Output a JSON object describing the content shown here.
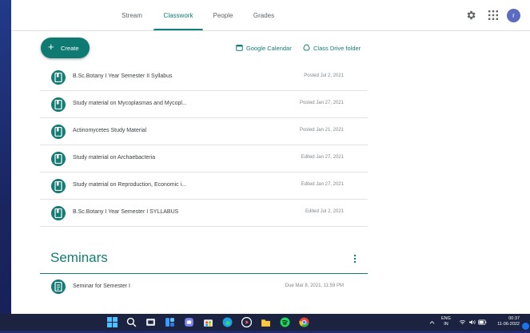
{
  "nav": {
    "tabs": [
      {
        "label": "Stream",
        "active": false
      },
      {
        "label": "Classwork",
        "active": true
      },
      {
        "label": "People",
        "active": false
      },
      {
        "label": "Grades",
        "active": false
      }
    ],
    "avatar_letter": "r",
    "icons": {
      "settings": "gear-icon",
      "apps": "apps-grid-icon"
    }
  },
  "toolbar": {
    "create_label": "Create",
    "calendar_label": "Google Calendar",
    "drive_label": "Class Drive folder"
  },
  "materials": [
    {
      "title": "B.Sc.Botany I Year Semester II Syllabus",
      "meta": "Posted Jul 2, 2021"
    },
    {
      "title": "Study material on Mycoplasmas and Mycopl...",
      "meta": "Posted Jan 27, 2021"
    },
    {
      "title": "Actinomycetes Study Material",
      "meta": "Posted Jan 21, 2021"
    },
    {
      "title": "Study material on Archaebacteria",
      "meta": "Edited Jan 27, 2021"
    },
    {
      "title": "Study material on Reproduction, Economic i...",
      "meta": "Edited Jan 27, 2021"
    },
    {
      "title": "B.Sc.Botany I Year Semester I SYLLABUS",
      "meta": "Edited Jul 2, 2021"
    }
  ],
  "seminars": {
    "title": "Seminars",
    "items": [
      {
        "title": "Seminar for Semester I",
        "meta": "Due Mar 8, 2021, 11:59 PM"
      }
    ]
  },
  "taskbar": {
    "lang_line1": "ENG",
    "lang_line2": "IN",
    "time": "00:37",
    "date": "11-06-2022"
  },
  "colors": {
    "accent": "#137c74",
    "avatar": "#5c6bc0",
    "taskbar": "#1b2340"
  }
}
